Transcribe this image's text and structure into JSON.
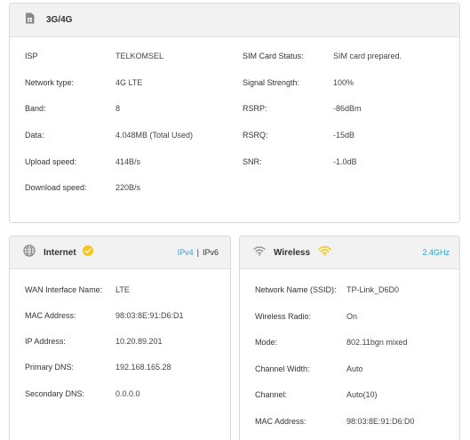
{
  "mobile": {
    "title": "3G/4G",
    "left": [
      {
        "label": "ISP",
        "value": "TELKOMSEL"
      },
      {
        "label": "Network type:",
        "value": "4G LTE"
      },
      {
        "label": "Band:",
        "value": "8"
      },
      {
        "label": "Data:",
        "value": "4.048MB (Total Used)"
      },
      {
        "label": "Upload speed:",
        "value": "414B/s"
      },
      {
        "label": "Download speed:",
        "value": "220B/s"
      }
    ],
    "right": [
      {
        "label": "SIM Card Status:",
        "value": "SIM card prepared."
      },
      {
        "label": "Signal Strength:",
        "value": "100%"
      },
      {
        "label": "RSRP:",
        "value": "-86dBm"
      },
      {
        "label": "RSRQ:",
        "value": "-15dB"
      },
      {
        "label": "SNR:",
        "value": "-1.0dB"
      }
    ]
  },
  "internet": {
    "title": "Internet",
    "ipv4_label": "IPv4",
    "separator": "|",
    "ipv6_label": "IPv6",
    "rows": [
      {
        "label": "WAN Interface Name:",
        "value": "LTE"
      },
      {
        "label": "MAC Address:",
        "value": "98:03:8E:91:D6:D1"
      },
      {
        "label": "IP Address:",
        "value": "10.20.89.201"
      },
      {
        "label": "Primary DNS:",
        "value": "192.168.165.28"
      },
      {
        "label": "Secondary DNS:",
        "value": "0.0.0.0"
      }
    ]
  },
  "wireless": {
    "title": "Wireless",
    "band": "2.4GHz",
    "rows": [
      {
        "label": "Network Name (SSID):",
        "value": "TP-Link_D6D0"
      },
      {
        "label": "Wireless Radio:",
        "value": "On"
      },
      {
        "label": "Mode:",
        "value": "802.11bgn mixed"
      },
      {
        "label": "Channel Width:",
        "value": "Auto"
      },
      {
        "label": "Channel:",
        "value": "Auto(10)"
      },
      {
        "label": "MAC Address:",
        "value": "98:03:8E:91:D6:D0"
      }
    ]
  },
  "colors": {
    "accent_blue": "#2ba6cb",
    "badge_yellow": "#f5c518",
    "header_gray": "#f2f2f2",
    "icon_gray": "#8a8a8a"
  },
  "icons": {
    "mobile": "sim-card-icon",
    "internet": "globe-icon",
    "internet_status": "check-badge-icon",
    "wireless": "wifi-icon",
    "wireless_status": "wifi-active-icon"
  }
}
